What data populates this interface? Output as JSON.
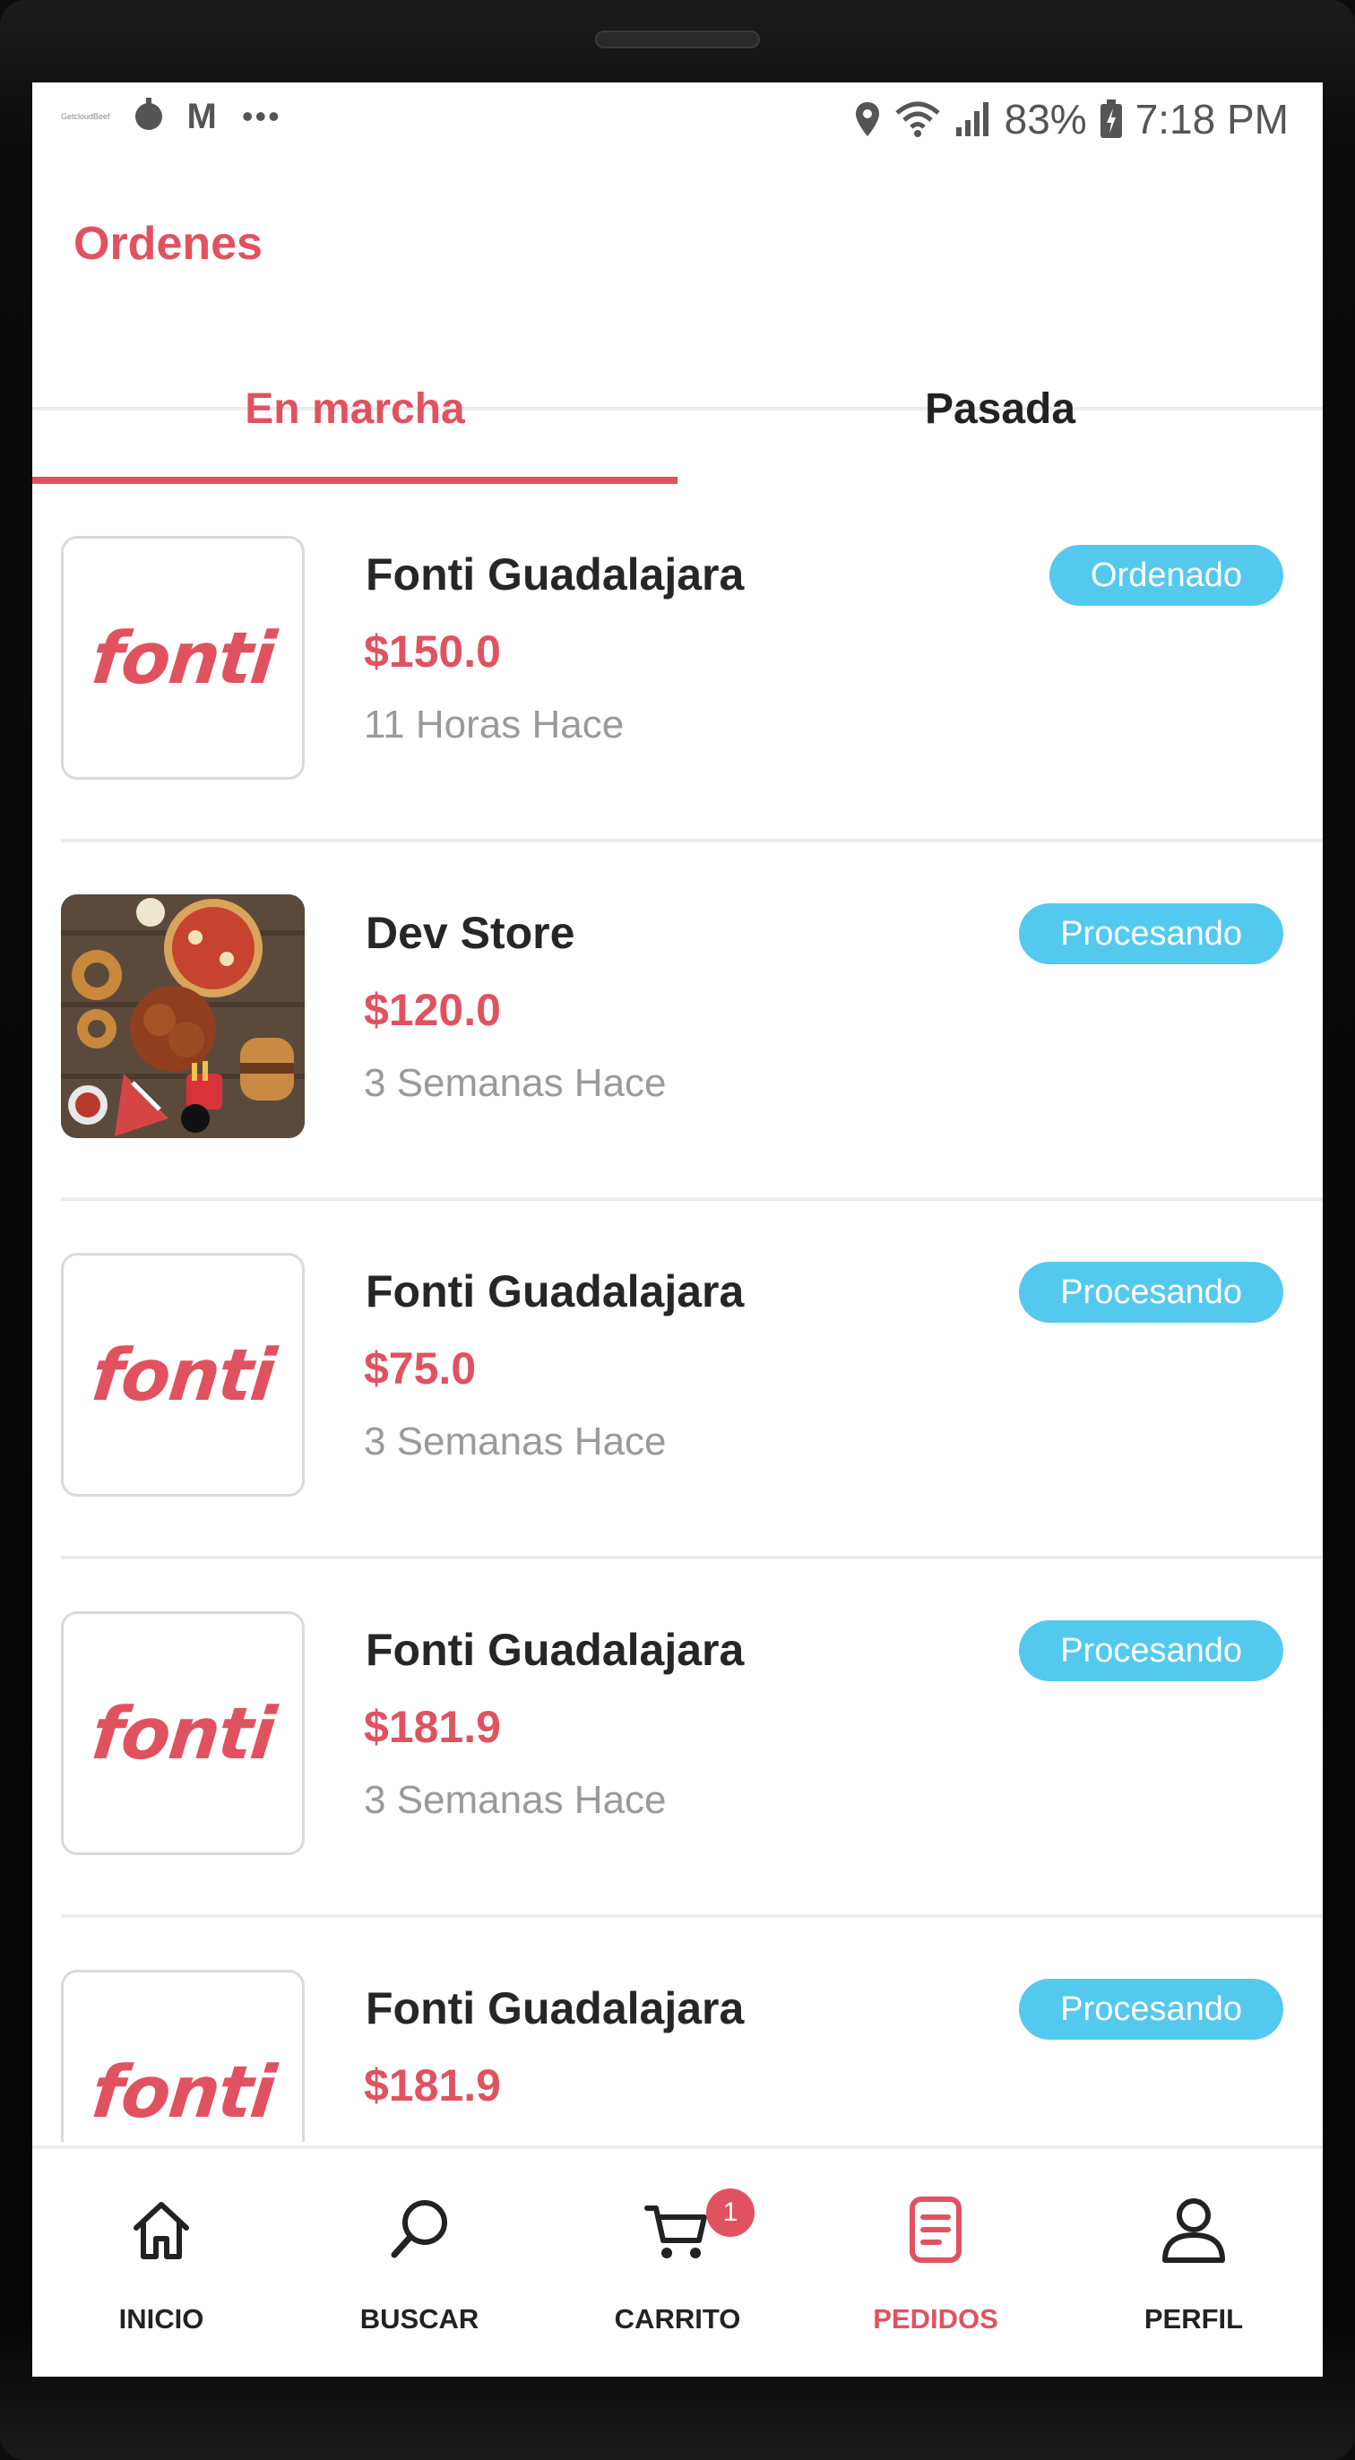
{
  "status_bar": {
    "left_tiny_text": "GetcloudBeef",
    "gmail_glyph": "M",
    "more_glyph": "•••",
    "battery_percent": "83%",
    "time": "7:18 PM",
    "icons": [
      "location-icon",
      "wifi-icon",
      "signal-icon",
      "battery-icon"
    ]
  },
  "header": {
    "title": "Ordenes"
  },
  "tabs": [
    {
      "label": "En marcha",
      "active": true
    },
    {
      "label": "Pasada",
      "active": false
    }
  ],
  "orders": [
    {
      "store": "Fonti Guadalajara",
      "price": "$150.0",
      "time": "11 Horas Hace",
      "status": "Ordenado",
      "thumb_text": "fonti"
    },
    {
      "store": "Dev Store",
      "price": "$120.0",
      "time": "3 Semanas Hace",
      "status": "Procesando",
      "thumb_text": ""
    },
    {
      "store": "Fonti Guadalajara",
      "price": "$75.0",
      "time": "3 Semanas Hace",
      "status": "Procesando",
      "thumb_text": "fonti"
    },
    {
      "store": "Fonti Guadalajara",
      "price": "$181.9",
      "time": "3 Semanas Hace",
      "status": "Procesando",
      "thumb_text": "fonti"
    },
    {
      "store": "Fonti Guadalajara",
      "price": "$181.9",
      "time": "",
      "status": "Procesando",
      "thumb_text": "fonti"
    }
  ],
  "bottom_nav": [
    {
      "label": "INICIO",
      "icon": "home-icon"
    },
    {
      "label": "BUSCAR",
      "icon": "search-icon"
    },
    {
      "label": "CARRITO",
      "icon": "cart-icon",
      "badge": "1"
    },
    {
      "label": "PEDIDOS",
      "icon": "orders-icon",
      "active": true
    },
    {
      "label": "PERFIL",
      "icon": "profile-icon"
    }
  ],
  "colors": {
    "accent": "#e15260",
    "badge": "#54c9ee",
    "text": "#262626",
    "muted": "#9a9a9a"
  }
}
